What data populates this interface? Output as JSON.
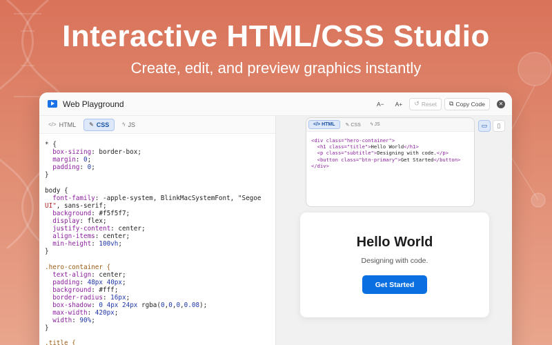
{
  "header": {
    "title": "Interactive HTML/CSS Studio",
    "subtitle": "Create, edit, and preview graphics instantly"
  },
  "colors": {
    "background": "#dd7e63",
    "accent": "#0a6fe0",
    "tab_active_bg": "#dde9fb"
  },
  "window": {
    "title": "Web Playground",
    "app_icon": "play-icon",
    "toolbar": {
      "font_decrease": "A−",
      "font_increase": "A+",
      "reset_label": "Reset",
      "copy_label": "Copy Code",
      "close_icon": "close-icon"
    },
    "editor_tabs": [
      {
        "icon": "</>",
        "label": "HTML"
      },
      {
        "icon": "✎",
        "label": "CSS"
      },
      {
        "icon": "ϟ",
        "label": "JS"
      }
    ],
    "active_tab": "CSS",
    "css_lines": [
      "* {",
      "  box-sizing: border-box;",
      "  margin: 0;",
      "  padding: 0;",
      "}",
      "",
      "body {",
      "  font-family: -apple-system, BlinkMacSystemFont, \"Segoe",
      "UI\", sans-serif;",
      "  background: #f5f5f7;",
      "  display: flex;",
      "  justify-content: center;",
      "  align-items: center;",
      "  min-height: 100vh;",
      "}",
      "",
      ".hero-container {",
      "  text-align: center;",
      "  padding: 48px 40px;",
      "  background: #fff;",
      "  border-radius: 16px;",
      "  box-shadow: 0 4px 24px rgba(0,0,0,0.08);",
      "  max-width: 420px;",
      "  width: 90%;",
      "}",
      "",
      ".title {"
    ],
    "mini_editor": {
      "tabs": [
        {
          "icon": "</>",
          "label": "HTML"
        },
        {
          "icon": "✎",
          "label": "CSS"
        },
        {
          "icon": "ϟ",
          "label": "JS"
        }
      ],
      "active_tab": "HTML",
      "html_lines": [
        "<div class=\"hero-container\">",
        "  <h1 class=\"title\">Hello World</h1>",
        "  <p class=\"subtitle\">Designing with code.</p>",
        "  <button class=\"btn-primary\">Get Started</button>",
        "</div>"
      ]
    },
    "view_buttons": [
      "desktop-icon",
      "mobile-icon"
    ],
    "preview": {
      "title": "Hello World",
      "subtitle": "Designing with code.",
      "button_label": "Get Started"
    }
  }
}
